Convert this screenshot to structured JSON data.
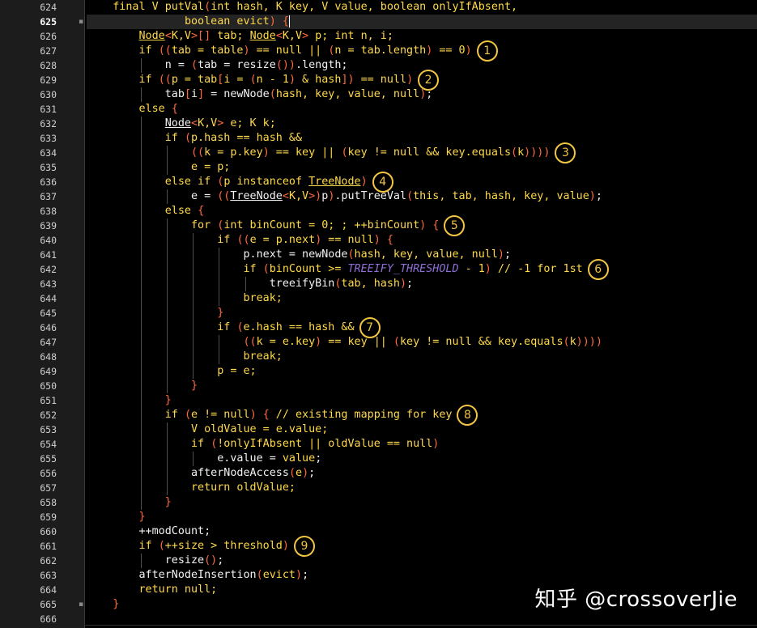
{
  "editor": {
    "current_line_index": 1,
    "lines": [
      {
        "n": "624",
        "indent": 1,
        "seg": [
          [
            "k",
            "final V putVal"
          ],
          [
            "p",
            "("
          ],
          [
            "k",
            "int hash, K key, V value, boolean onlyIfAbsent,"
          ]
        ]
      },
      {
        "n": "625",
        "indent": 0,
        "pad": "               ",
        "seg": [
          [
            "k",
            "boolean evict"
          ],
          [
            "p",
            ")"
          ],
          [
            "w",
            " "
          ],
          [
            "p",
            "{"
          ]
        ],
        "cursor": true
      },
      {
        "n": "626",
        "indent": 2,
        "seg": [
          [
            "ku",
            "Node"
          ],
          [
            "p",
            "<"
          ],
          [
            "k",
            "K,V"
          ],
          [
            "p",
            ">[]"
          ],
          [
            "k",
            " tab; "
          ],
          [
            "ku",
            "Node"
          ],
          [
            "p",
            "<"
          ],
          [
            "k",
            "K,V"
          ],
          [
            "p",
            ">"
          ],
          [
            "k",
            " p; int n, i;"
          ]
        ]
      },
      {
        "n": "627",
        "indent": 2,
        "seg": [
          [
            "k",
            "if "
          ],
          [
            "p",
            "(("
          ],
          [
            "k",
            "tab = table"
          ],
          [
            "p",
            ")"
          ],
          [
            "k",
            " == null || "
          ],
          [
            "p",
            "("
          ],
          [
            "k",
            "n = tab.length"
          ],
          [
            "p",
            ")"
          ],
          [
            "k",
            " == 0"
          ],
          [
            "p",
            ")"
          ]
        ]
      },
      {
        "n": "628",
        "indent": 3,
        "seg": [
          [
            "w",
            "n = "
          ],
          [
            "p",
            "("
          ],
          [
            "w",
            "tab = resize"
          ],
          [
            "p",
            "())"
          ],
          [
            "w",
            ".length;"
          ]
        ]
      },
      {
        "n": "629",
        "indent": 2,
        "seg": [
          [
            "k",
            "if "
          ],
          [
            "p",
            "(("
          ],
          [
            "k",
            "p = tab"
          ],
          [
            "p",
            "["
          ],
          [
            "k",
            "i = "
          ],
          [
            "p",
            "("
          ],
          [
            "k",
            "n - 1"
          ],
          [
            "p",
            ")"
          ],
          [
            "k",
            " & hash"
          ],
          [
            "p",
            "])"
          ],
          [
            "k",
            " == null"
          ],
          [
            "p",
            ")"
          ]
        ]
      },
      {
        "n": "630",
        "indent": 3,
        "seg": [
          [
            "w",
            "tab"
          ],
          [
            "p",
            "["
          ],
          [
            "w",
            "i"
          ],
          [
            "p",
            "]"
          ],
          [
            "w",
            " = newNode"
          ],
          [
            "p",
            "("
          ],
          [
            "k",
            "hash, key, value, null"
          ],
          [
            "p",
            ")"
          ],
          [
            "w",
            ";"
          ]
        ]
      },
      {
        "n": "631",
        "indent": 2,
        "seg": [
          [
            "k",
            "else "
          ],
          [
            "p",
            "{"
          ]
        ]
      },
      {
        "n": "632",
        "indent": 3,
        "seg": [
          [
            "wu",
            "Node"
          ],
          [
            "p",
            "<"
          ],
          [
            "k",
            "K,V"
          ],
          [
            "p",
            ">"
          ],
          [
            "k",
            " e; K k;"
          ]
        ]
      },
      {
        "n": "633",
        "indent": 3,
        "seg": [
          [
            "k",
            "if "
          ],
          [
            "p",
            "("
          ],
          [
            "k",
            "p.hash == hash &&"
          ]
        ]
      },
      {
        "n": "634",
        "indent": 4,
        "seg": [
          [
            "p",
            "(("
          ],
          [
            "k",
            "k = p.key"
          ],
          [
            "p",
            ")"
          ],
          [
            "k",
            " == key || "
          ],
          [
            "p",
            "("
          ],
          [
            "k",
            "key != null && key.equals"
          ],
          [
            "p",
            "("
          ],
          [
            "k",
            "k"
          ],
          [
            "p",
            "))))"
          ]
        ]
      },
      {
        "n": "635",
        "indent": 4,
        "seg": [
          [
            "k",
            "e = p;"
          ]
        ]
      },
      {
        "n": "636",
        "indent": 3,
        "seg": [
          [
            "k",
            "else if "
          ],
          [
            "p",
            "("
          ],
          [
            "k",
            "p instanceof "
          ],
          [
            "ku",
            "TreeNode"
          ],
          [
            "p",
            ")"
          ]
        ]
      },
      {
        "n": "637",
        "indent": 4,
        "seg": [
          [
            "w",
            "e = "
          ],
          [
            "p",
            "(("
          ],
          [
            "wu",
            "TreeNode"
          ],
          [
            "p",
            "<"
          ],
          [
            "k",
            "K,V"
          ],
          [
            "p",
            ">)"
          ],
          [
            "w",
            "p"
          ],
          [
            "p",
            ")"
          ],
          [
            "w",
            ".putTreeVal"
          ],
          [
            "p",
            "("
          ],
          [
            "k",
            "this, tab, hash, key, value"
          ],
          [
            "p",
            ")"
          ],
          [
            "w",
            ";"
          ]
        ]
      },
      {
        "n": "638",
        "indent": 3,
        "seg": [
          [
            "k",
            "else "
          ],
          [
            "p",
            "{"
          ]
        ]
      },
      {
        "n": "639",
        "indent": 4,
        "seg": [
          [
            "k",
            "for "
          ],
          [
            "p",
            "("
          ],
          [
            "k",
            "int binCount = 0; ; ++binCount"
          ],
          [
            "p",
            ")"
          ],
          [
            "k",
            " "
          ],
          [
            "p",
            "{"
          ]
        ]
      },
      {
        "n": "640",
        "indent": 5,
        "seg": [
          [
            "k",
            "if "
          ],
          [
            "p",
            "(("
          ],
          [
            "k",
            "e = p.next"
          ],
          [
            "p",
            ")"
          ],
          [
            "k",
            " == null"
          ],
          [
            "p",
            ")"
          ],
          [
            "k",
            " "
          ],
          [
            "p",
            "{"
          ]
        ]
      },
      {
        "n": "641",
        "indent": 6,
        "seg": [
          [
            "w",
            "p.next = newNode"
          ],
          [
            "p",
            "("
          ],
          [
            "k",
            "hash, key, value, null"
          ],
          [
            "p",
            ")"
          ],
          [
            "w",
            ";"
          ]
        ]
      },
      {
        "n": "642",
        "indent": 6,
        "seg": [
          [
            "k",
            "if "
          ],
          [
            "p",
            "("
          ],
          [
            "k",
            "binCount >= "
          ],
          [
            "c",
            "TREEIFY_THRESHOLD"
          ],
          [
            "k",
            " - 1"
          ],
          [
            "p",
            ")"
          ],
          [
            "k",
            " // -1 for 1st"
          ]
        ]
      },
      {
        "n": "643",
        "indent": 7,
        "seg": [
          [
            "w",
            "treeifyBin"
          ],
          [
            "p",
            "("
          ],
          [
            "k",
            "tab, hash"
          ],
          [
            "p",
            ")"
          ],
          [
            "w",
            ";"
          ]
        ]
      },
      {
        "n": "644",
        "indent": 6,
        "seg": [
          [
            "k",
            "break;"
          ]
        ]
      },
      {
        "n": "645",
        "indent": 5,
        "seg": [
          [
            "p",
            "}"
          ]
        ]
      },
      {
        "n": "646",
        "indent": 5,
        "seg": [
          [
            "k",
            "if "
          ],
          [
            "p",
            "("
          ],
          [
            "k",
            "e.hash == hash &&"
          ]
        ]
      },
      {
        "n": "647",
        "indent": 6,
        "seg": [
          [
            "p",
            "(("
          ],
          [
            "k",
            "k = e.key"
          ],
          [
            "p",
            ")"
          ],
          [
            "k",
            " == key || "
          ],
          [
            "p",
            "("
          ],
          [
            "k",
            "key != null && key.equals"
          ],
          [
            "p",
            "("
          ],
          [
            "k",
            "k"
          ],
          [
            "p",
            "))))"
          ]
        ]
      },
      {
        "n": "648",
        "indent": 6,
        "seg": [
          [
            "k",
            "break;"
          ]
        ]
      },
      {
        "n": "649",
        "indent": 5,
        "seg": [
          [
            "k",
            "p = e;"
          ]
        ]
      },
      {
        "n": "650",
        "indent": 4,
        "seg": [
          [
            "p",
            "}"
          ]
        ]
      },
      {
        "n": "651",
        "indent": 3,
        "seg": [
          [
            "p",
            "}"
          ]
        ]
      },
      {
        "n": "652",
        "indent": 3,
        "seg": [
          [
            "k",
            "if "
          ],
          [
            "p",
            "("
          ],
          [
            "k",
            "e != null"
          ],
          [
            "p",
            ")"
          ],
          [
            "k",
            " "
          ],
          [
            "p",
            "{"
          ],
          [
            "k",
            " // existing mapping for key"
          ]
        ]
      },
      {
        "n": "653",
        "indent": 4,
        "seg": [
          [
            "k",
            "V oldValue = e.value;"
          ]
        ]
      },
      {
        "n": "654",
        "indent": 4,
        "seg": [
          [
            "k",
            "if "
          ],
          [
            "p",
            "("
          ],
          [
            "k",
            "!onlyIfAbsent || oldValue == null"
          ],
          [
            "p",
            ")"
          ]
        ]
      },
      {
        "n": "655",
        "indent": 5,
        "seg": [
          [
            "w",
            "e.value = "
          ],
          [
            "k",
            "value"
          ],
          [
            "w",
            ";"
          ]
        ]
      },
      {
        "n": "656",
        "indent": 4,
        "seg": [
          [
            "w",
            "afterNodeAccess"
          ],
          [
            "p",
            "("
          ],
          [
            "k",
            "e"
          ],
          [
            "p",
            ")"
          ],
          [
            "w",
            ";"
          ]
        ]
      },
      {
        "n": "657",
        "indent": 4,
        "seg": [
          [
            "k",
            "return oldValue;"
          ]
        ]
      },
      {
        "n": "658",
        "indent": 3,
        "seg": [
          [
            "p",
            "}"
          ]
        ]
      },
      {
        "n": "659",
        "indent": 2,
        "seg": [
          [
            "p",
            "}"
          ]
        ]
      },
      {
        "n": "660",
        "indent": 2,
        "seg": [
          [
            "w",
            "++modCount;"
          ]
        ]
      },
      {
        "n": "661",
        "indent": 2,
        "seg": [
          [
            "k",
            "if "
          ],
          [
            "p",
            "("
          ],
          [
            "k",
            "++size > threshold"
          ],
          [
            "p",
            ")"
          ]
        ]
      },
      {
        "n": "662",
        "indent": 3,
        "seg": [
          [
            "w",
            "resize"
          ],
          [
            "p",
            "()"
          ],
          [
            "w",
            ";"
          ]
        ]
      },
      {
        "n": "663",
        "indent": 2,
        "seg": [
          [
            "w",
            "afterNodeInsertion"
          ],
          [
            "p",
            "("
          ],
          [
            "k",
            "evict"
          ],
          [
            "p",
            ")"
          ],
          [
            "w",
            ";"
          ]
        ]
      },
      {
        "n": "664",
        "indent": 2,
        "seg": [
          [
            "k",
            "return null;"
          ]
        ]
      },
      {
        "n": "665",
        "indent": 1,
        "seg": [
          [
            "p",
            "}"
          ]
        ]
      },
      {
        "n": "666",
        "indent": 0,
        "seg": []
      }
    ]
  },
  "annotations": [
    "①",
    "②",
    "③",
    "④",
    "⑤",
    "⑥",
    "⑦",
    "⑧",
    "⑨"
  ],
  "badges": [
    {
      "label": "1",
      "line": 3
    },
    {
      "label": "2",
      "line": 5
    },
    {
      "label": "3",
      "line": 10
    },
    {
      "label": "4",
      "line": 12
    },
    {
      "label": "5",
      "line": 15
    },
    {
      "label": "6",
      "line": 18
    },
    {
      "label": "7",
      "line": 22
    },
    {
      "label": "8",
      "line": 28
    },
    {
      "label": "9",
      "line": 37
    }
  ],
  "watermark": "知乎 @crossoverJie"
}
